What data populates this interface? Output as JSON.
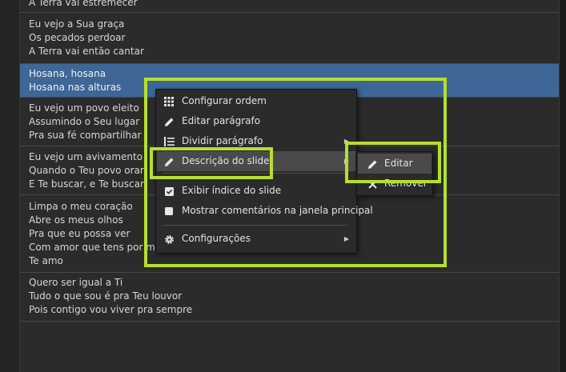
{
  "slides": [
    {
      "lines": [
        "A Terra vai estremecer"
      ],
      "selected": false
    },
    {
      "lines": [
        "Eu vejo a Sua graça",
        "Os pecados perdoar",
        "A Terra vai então cantar"
      ],
      "selected": false
    },
    {
      "lines": [
        "Hosana, hosana",
        "Hosana nas alturas"
      ],
      "selected": true
    },
    {
      "lines": [
        "Eu vejo um povo eleito",
        "Assumindo o Seu lugar",
        "Pra sua fé compartilhar"
      ],
      "selected": false
    },
    {
      "lines": [
        "Eu vejo um avivamento",
        "Quando o Teu povo orar",
        "E Te buscar, e Te buscar"
      ],
      "selected": false
    },
    {
      "lines": [
        "Limpa o meu coração",
        "Abre os meus olhos",
        "Pra que eu possa ver",
        "Com amor que tens por mim",
        "Te amo"
      ],
      "selected": false
    },
    {
      "lines": [
        "Quero ser igual a Ti",
        "Tudo o que sou é pra Teu louvor",
        "Pois contigo vou viver pra sempre"
      ],
      "selected": false
    }
  ],
  "context_menu": {
    "items": [
      {
        "label": "Configurar ordem",
        "icon": "grid-icon",
        "submenu": false
      },
      {
        "label": "Editar parágrafo",
        "icon": "pencil-icon",
        "submenu": false
      },
      {
        "label": "Dividir parágrafo",
        "icon": "split-lines-icon",
        "submenu": true
      },
      {
        "label": "Descrição do slide",
        "icon": "pencil-icon",
        "submenu": true,
        "active": true
      },
      {
        "label": "Exibir índice do slide",
        "icon": "checkbox-checked-icon",
        "submenu": false,
        "checked": true
      },
      {
        "label": "Mostrar comentários na janela principal",
        "icon": "checkbox-unchecked-icon",
        "submenu": false,
        "checked": false
      },
      {
        "label": "Configurações",
        "icon": "gear-icon",
        "submenu": true
      }
    ]
  },
  "submenu": {
    "items": [
      {
        "label": "Editar",
        "icon": "pencil-icon",
        "active": true
      },
      {
        "label": "Remover",
        "icon": "close-icon",
        "active": false
      }
    ]
  },
  "colors": {
    "selection": "#3e6797",
    "highlight_box": "#b5df2f",
    "menu_bg": "#2b2b2b"
  }
}
